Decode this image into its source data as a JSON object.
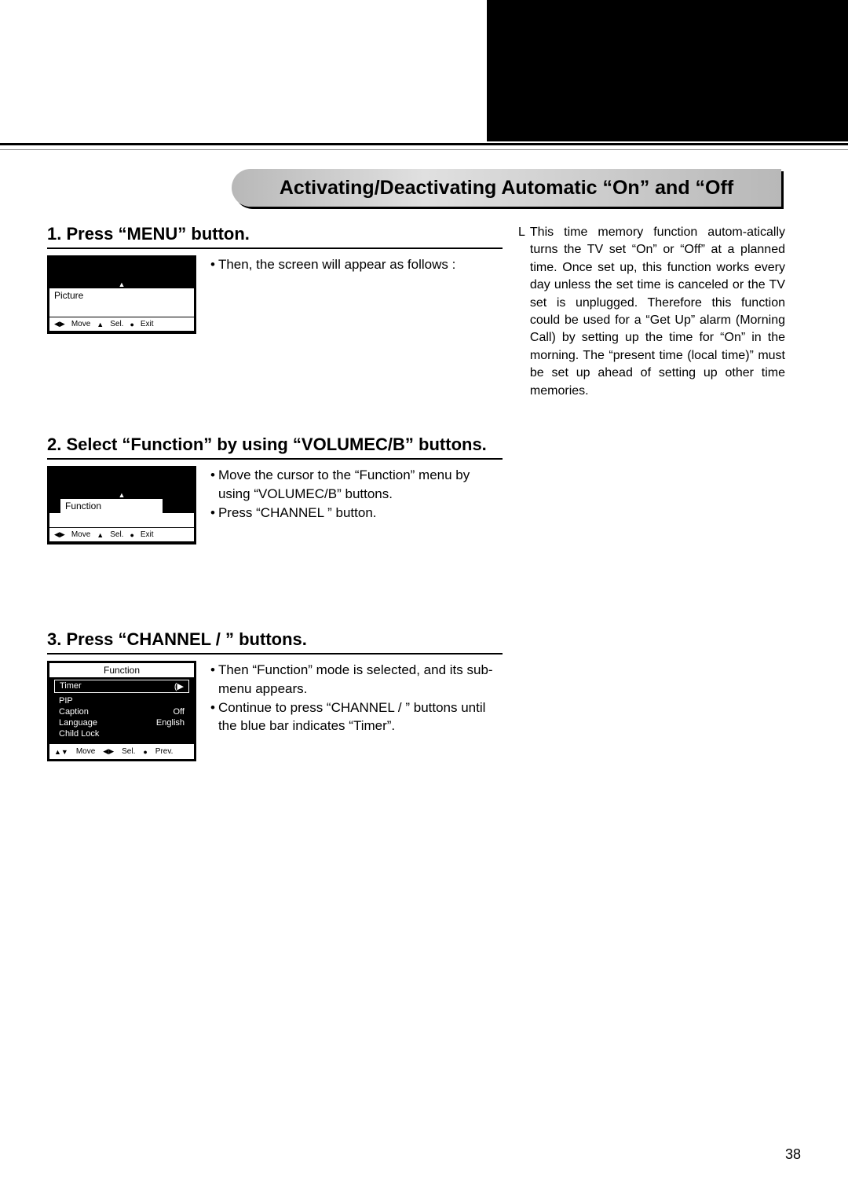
{
  "banner": "Activating/Deactivating Automatic “On” and “Off",
  "step1": {
    "heading": "1. Press “MENU” button.",
    "text": "Then, the screen will appear as follows :",
    "osd_label": "Picture",
    "osd_move": "Move",
    "osd_sel": "Sel.",
    "osd_exit": "Exit"
  },
  "step2": {
    "heading": "2. Select “Function” by using “VOLUMEC/B” buttons.",
    "text1": "Move the cursor to the “Function” menu by using “VOLUMEC/B” buttons.",
    "text2": "Press “CHANNEL   ” button.",
    "osd_label": "Function",
    "osd_move": "Move",
    "osd_sel": "Sel.",
    "osd_exit": "Exit"
  },
  "step3": {
    "heading": "3. Press “CHANNEL    /    ” buttons.",
    "text1": "Then “Function” mode is selected, and its sub-menu appears.",
    "text2": "Continue to press “CHANNEL    /   ” buttons until the blue bar indicates “Timer”.",
    "osd_title": "Function",
    "rows": [
      {
        "label": "Timer",
        "value": "(▶"
      },
      {
        "label": "PIP",
        "value": ""
      },
      {
        "label": "Caption",
        "value": "Off"
      },
      {
        "label": "Language",
        "value": "English"
      },
      {
        "label": "Child Lock",
        "value": ""
      }
    ],
    "osd_move": "Move",
    "osd_sel": "Sel.",
    "osd_prev": "Prev."
  },
  "side": {
    "bullet": "L",
    "text": "This time memory function autom-atically turns the TV set “On” or “Off” at a planned time. Once set up, this function works every day unless the set time is canceled or the TV set is unplugged. Therefore this function could be used for a “Get Up” alarm (Morning Call) by setting up the time for “On” in the morning. The “present time (local time)” must be set up ahead of setting up other time memories."
  },
  "page": "38"
}
